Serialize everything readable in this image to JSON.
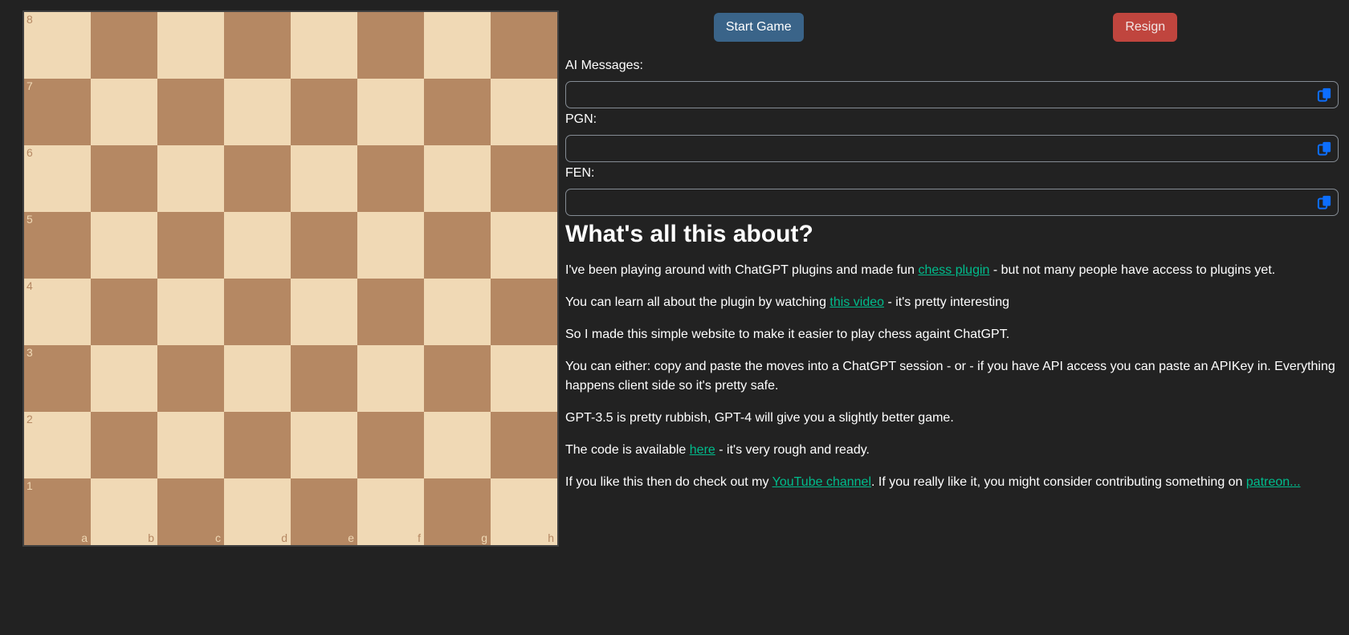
{
  "board": {
    "ranks": [
      "8",
      "7",
      "6",
      "5",
      "4",
      "3",
      "2",
      "1"
    ],
    "files": [
      "a",
      "b",
      "c",
      "d",
      "e",
      "f",
      "g",
      "h"
    ],
    "light_color": "#f0d9b5",
    "dark_color": "#b58863"
  },
  "toolbar": {
    "start_label": "Start Game",
    "resign_label": "Resign"
  },
  "fields": [
    {
      "id": "ai-messages",
      "label": "AI Messages:",
      "value": "",
      "icon": "copy-icon"
    },
    {
      "id": "pgn",
      "label": "PGN:",
      "value": "",
      "icon": "copy-icon"
    },
    {
      "id": "fen",
      "label": "FEN:",
      "value": "",
      "icon": "copy-icon"
    }
  ],
  "about": {
    "heading": "What's all this about?",
    "paragraphs": [
      {
        "segments": [
          {
            "text": "I've been playing around with ChatGPT plugins and made fun "
          },
          {
            "text": "chess plugin",
            "link": true
          },
          {
            "text": " - but not many people have access to plugins yet."
          }
        ]
      },
      {
        "segments": [
          {
            "text": "You can learn all about the plugin by watching "
          },
          {
            "text": "this video",
            "link": true
          },
          {
            "text": " - it's pretty interesting"
          }
        ]
      },
      {
        "segments": [
          {
            "text": "So I made this simple website to make it easier to play chess againt ChatGPT."
          }
        ]
      },
      {
        "segments": [
          {
            "text": "You can either: copy and paste the moves into a ChatGPT session - or - if you have API access you can paste an APIKey in. Everything happens client side so it's pretty safe."
          }
        ]
      },
      {
        "segments": [
          {
            "text": "GPT-3.5 is pretty rubbish, GPT-4 will give you a slightly better game."
          }
        ]
      },
      {
        "segments": [
          {
            "text": "The code is available "
          },
          {
            "text": "here",
            "link": true
          },
          {
            "text": " - it's very rough and ready."
          }
        ]
      },
      {
        "segments": [
          {
            "text": "If you like this then do check out my "
          },
          {
            "text": "YouTube channel",
            "link": true
          },
          {
            "text": ". If you really like it, you might consider contributing something on "
          },
          {
            "text": "patreon...",
            "link": true
          }
        ]
      }
    ]
  },
  "colors": {
    "background": "#222222",
    "link_green": "#00bc8c",
    "primary_button": "#3a6489",
    "danger_button": "#c0453e",
    "input_border": "#858c94",
    "copy_icon_blue": "#0d6efd",
    "board_light": "#f0d9b5",
    "board_dark": "#b58863",
    "board_border": "#404040"
  }
}
